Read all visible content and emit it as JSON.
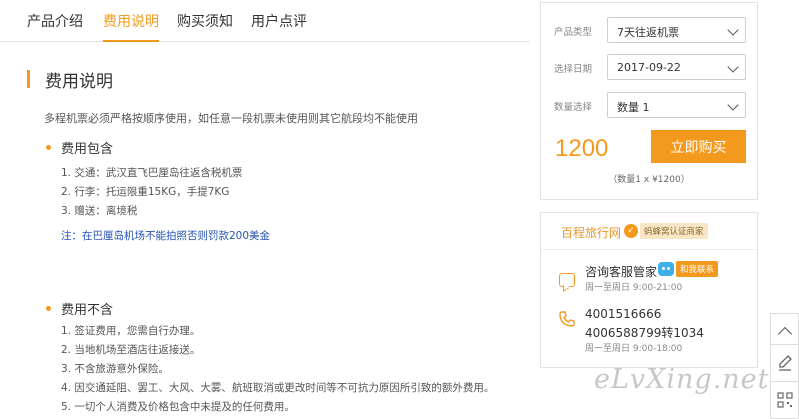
{
  "tabs": [
    {
      "label": "产品介绍"
    },
    {
      "label": "费用说明",
      "active": true
    },
    {
      "label": "购买须知"
    },
    {
      "label": "用户点评"
    }
  ],
  "section_title": "费用说明",
  "intro": "多程机票必须严格按顺序使用，如任意一段机票未使用则其它航段均不能使用",
  "included": {
    "title": "费用包含",
    "items": [
      "1. 交通：武汉直飞巴厘岛往返含税机票",
      "2. 行李：托运限重15KG，手提7KG",
      "3. 赠送：离境税"
    ],
    "note": "注：在巴厘岛机场不能拍照否则罚款200美金"
  },
  "excluded": {
    "title": "费用不含",
    "items": [
      "1. 签证费用，您需自行办理。",
      "2. 当地机场至酒店往返接送。",
      "3. 不含旅游意外保险。",
      "4. 因交通延阻、罢工、大风、大雾、航班取消或更改时间等不可抗力原因所引致的额外费用。",
      "5. 一切个人消费及价格包含中未提及的任何费用。"
    ]
  },
  "order": {
    "product_type_label": "产品类型",
    "product_type_value": "7天往返机票",
    "date_label": "选择日期",
    "date_value": "2017-09-22",
    "qty_label": "数量选择",
    "qty_value": "数量 1",
    "price": "1200",
    "buy_label": "立即购买",
    "calc": "（数量1 x ¥1200）"
  },
  "service": {
    "shop_name": "百程旅行网",
    "certified": "蚂蜂窝认证商家",
    "cs_title": "咨询客服管家",
    "cs_tag": "和我联系",
    "cs_hours": "周一至周日 9:00-21:00",
    "phone1": "4001516666",
    "phone2": "4006588799转1034",
    "phone_hours": "周一至周日 9:00-18:00"
  },
  "watermark": "eLvXing.net",
  "colors": {
    "accent": "#f39a1e",
    "note": "#2453b6"
  }
}
